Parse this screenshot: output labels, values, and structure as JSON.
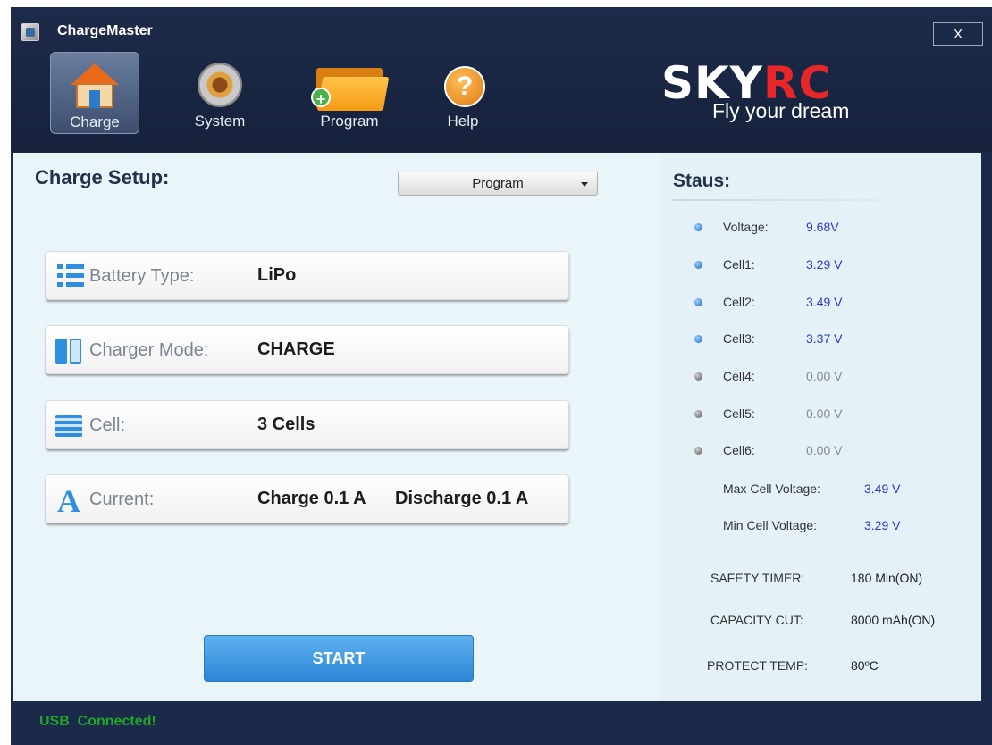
{
  "window": {
    "title": "ChargeMaster",
    "close_label": "X"
  },
  "nav": {
    "items": [
      {
        "label": "Charge",
        "icon": "house-icon",
        "active": true
      },
      {
        "label": "System",
        "icon": "gear-icon",
        "active": false
      },
      {
        "label": "Program",
        "icon": "folder-add-icon",
        "active": false
      },
      {
        "label": "Help",
        "icon": "help-icon",
        "active": false
      }
    ]
  },
  "brand": {
    "logo_sky": "SKY",
    "logo_rc": "RC",
    "slogan": "Fly your dream"
  },
  "setup": {
    "title": "Charge Setup:",
    "program_select": "Program",
    "rows": [
      {
        "label": "Battery Type:",
        "value": "LiPo",
        "icon": "list-icon"
      },
      {
        "label": "Charger Mode:",
        "value": "CHARGE",
        "icon": "battery-icon"
      },
      {
        "label": "Cell:",
        "value": "3 Cells",
        "icon": "cells-icon"
      },
      {
        "label": "Current:",
        "value": "Charge 0.1 A",
        "value2": "Discharge 0.1 A",
        "icon": "ampere-icon"
      }
    ],
    "start_label": "START"
  },
  "status": {
    "title": "Staus:",
    "voltages": [
      {
        "label": "Voltage:",
        "value": "9.68V",
        "active": true
      },
      {
        "label": "Cell1:",
        "value": "3.29 V",
        "active": true
      },
      {
        "label": "Cell2:",
        "value": "3.49 V",
        "active": true
      },
      {
        "label": "Cell3:",
        "value": "3.37 V",
        "active": true
      },
      {
        "label": "Cell4:",
        "value": "0.00 V",
        "active": false
      },
      {
        "label": "Cell5:",
        "value": "0.00 V",
        "active": false
      },
      {
        "label": "Cell6:",
        "value": "0.00 V",
        "active": false
      }
    ],
    "max_cell": {
      "label": "Max Cell Voltage:",
      "value": "3.49 V"
    },
    "min_cell": {
      "label": "Min Cell Voltage:",
      "value": "3.29 V"
    },
    "safety_timer": {
      "label": "SAFETY TIMER:",
      "value": "180 Min(ON)"
    },
    "capacity_cut": {
      "label": "CAPACITY CUT:",
      "value": "8000 mAh(ON)"
    },
    "protect_temp": {
      "label": "PROTECT TEMP:",
      "value": "80ºC"
    }
  },
  "statusbar": {
    "text": "USB  Connected!"
  },
  "colors": {
    "header_bg": "#1b2a48",
    "accent_blue": "#2f8fde",
    "value_blue": "#2b37c9",
    "usb_green": "#22a52c",
    "brand_red": "#e8262a"
  }
}
